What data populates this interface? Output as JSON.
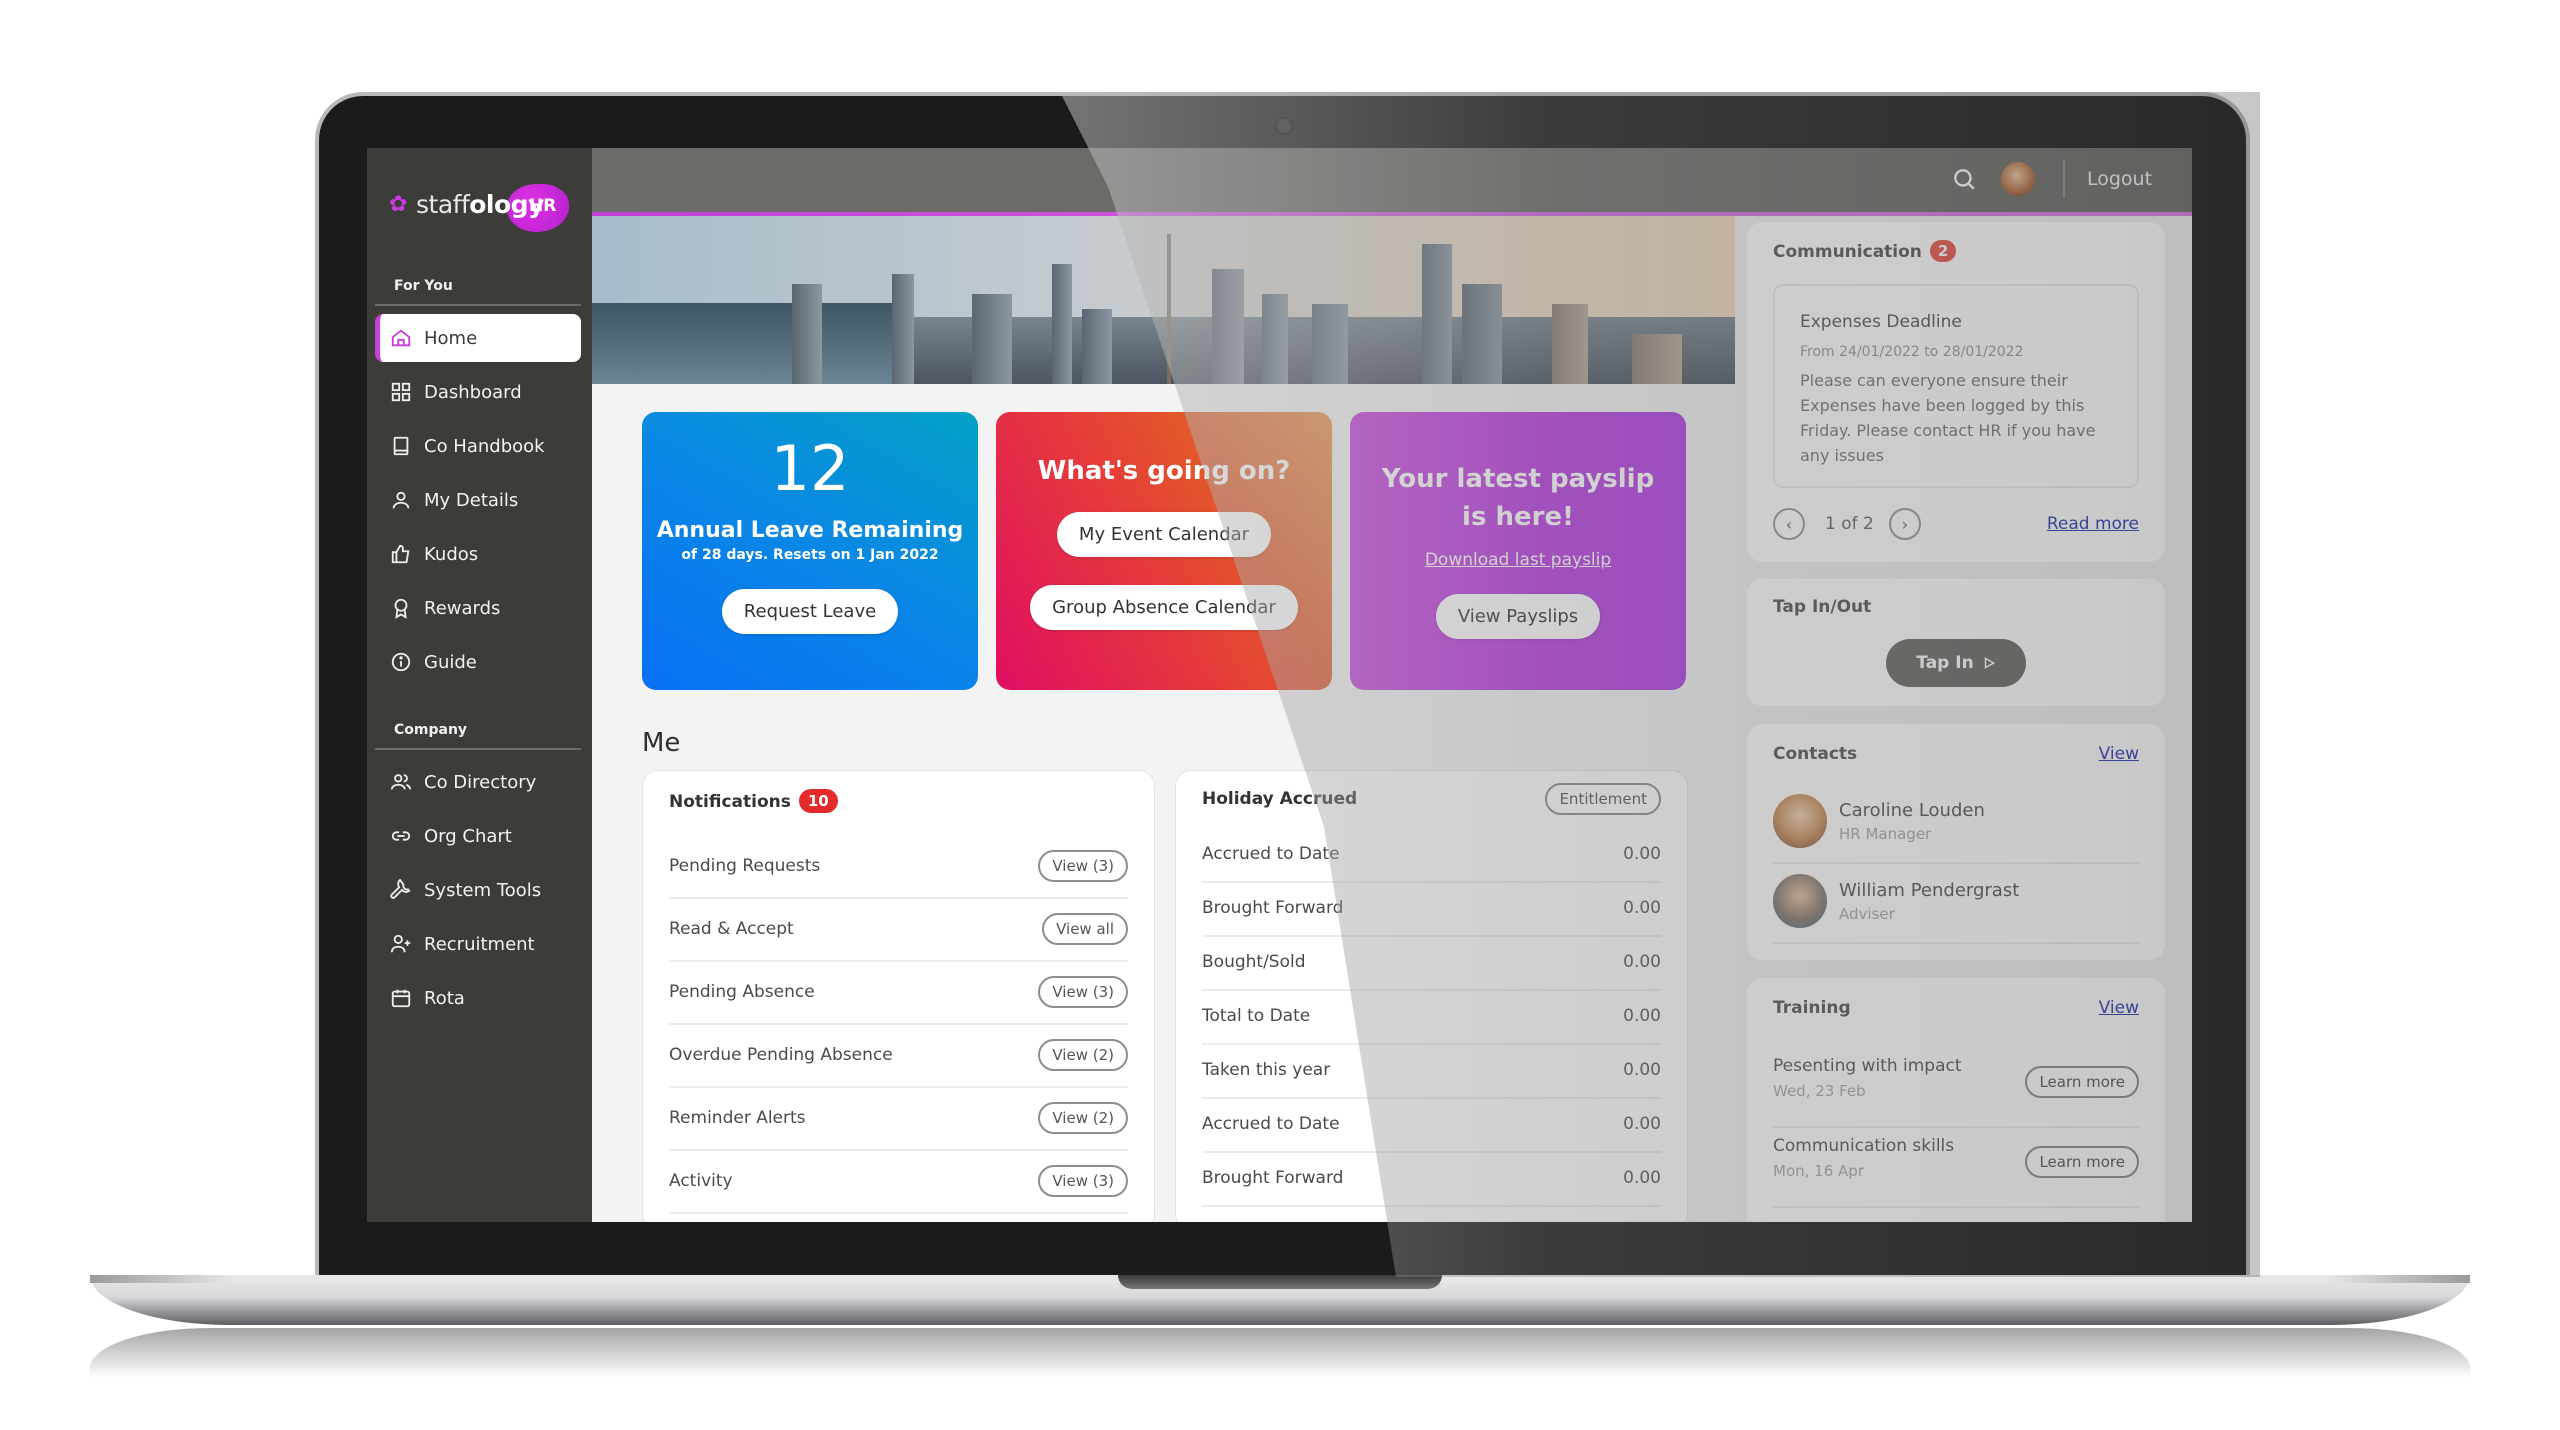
{
  "app": {
    "brand": {
      "prefix": "staff",
      "bold": "ology",
      "suffix": "HR"
    },
    "accent": "#c63fd9"
  },
  "topbar": {
    "search_icon": "search-icon",
    "logout_label": "Logout"
  },
  "sidebar": {
    "for_you_label": "For You",
    "for_you_items": [
      {
        "label": "Home",
        "icon": "home-icon",
        "active": true
      },
      {
        "label": "Dashboard",
        "icon": "grid-icon"
      },
      {
        "label": "Co Handbook",
        "icon": "book-icon"
      },
      {
        "label": "My Details",
        "icon": "user-icon"
      },
      {
        "label": "Kudos",
        "icon": "thumbs-up-icon"
      },
      {
        "label": "Rewards",
        "icon": "award-icon"
      },
      {
        "label": "Guide",
        "icon": "info-icon"
      }
    ],
    "company_label": "Company",
    "company_items": [
      {
        "label": "Co Directory",
        "icon": "users-icon"
      },
      {
        "label": "Org Chart",
        "icon": "link-icon"
      },
      {
        "label": "System Tools",
        "icon": "wrench-icon"
      },
      {
        "label": "Recruitment",
        "icon": "user-plus-icon"
      },
      {
        "label": "Rota",
        "icon": "calendar-icon"
      }
    ]
  },
  "hero": {
    "leave": {
      "count": "12",
      "title": "Annual Leave Remaining",
      "subtitle": "of 28 days. Resets on 1 Jan 2022",
      "button": "Request Leave"
    },
    "events": {
      "title": "What's going on?",
      "button1": "My Event Calendar",
      "button2": "Group Absence Calendar"
    },
    "payslip": {
      "title_line1": "Your latest payslip",
      "title_line2": "is here!",
      "link": "Download last payslip",
      "button": "View Payslips"
    }
  },
  "me": {
    "title": "Me",
    "notifications": {
      "title": "Notifications",
      "count": "10",
      "rows": [
        {
          "label": "Pending Requests",
          "button": "View (3)"
        },
        {
          "label": "Read & Accept",
          "button": "View all"
        },
        {
          "label": "Pending Absence",
          "button": "View (3)"
        },
        {
          "label": "Overdue Pending Absence",
          "button": "View (2)"
        },
        {
          "label": "Reminder Alerts",
          "button": "View (2)"
        },
        {
          "label": "Activity",
          "button": "View (3)"
        }
      ]
    },
    "holiday": {
      "title": "Holiday Accrued",
      "button": "Entitlement",
      "rows": [
        {
          "label": "Accrued to Date",
          "value": "0.00"
        },
        {
          "label": "Brought Forward",
          "value": "0.00"
        },
        {
          "label": "Bought/Sold",
          "value": "0.00"
        },
        {
          "label": "Total to Date",
          "value": "0.00"
        },
        {
          "label": "Taken this year",
          "value": "0.00"
        },
        {
          "label": "Accrued to Date",
          "value": "0.00"
        },
        {
          "label": "Brought Forward",
          "value": "0.00"
        }
      ]
    }
  },
  "communication": {
    "title": "Communication",
    "count": "2",
    "item": {
      "title": "Expenses Deadline",
      "dates": "From 24/01/2022 to 28/01/2022",
      "body": "Please can everyone ensure their Expenses have been logged by this Friday. Please contact HR if you have any issues"
    },
    "pager": "1 of 2",
    "read_more": "Read more"
  },
  "tap": {
    "title": "Tap In/Out",
    "button": "Tap In"
  },
  "contacts": {
    "title": "Contacts",
    "view": "View",
    "items": [
      {
        "name": "Caroline Louden",
        "role": "HR Manager"
      },
      {
        "name": "William Pendergrast",
        "role": "Adviser"
      }
    ]
  },
  "training": {
    "title": "Training",
    "view": "View",
    "items": [
      {
        "title": "Pesenting with impact",
        "date": "Wed, 23 Feb",
        "button": "Learn more"
      },
      {
        "title": "Communication skills",
        "date": "Mon, 16 Apr",
        "button": "Learn more"
      }
    ]
  }
}
